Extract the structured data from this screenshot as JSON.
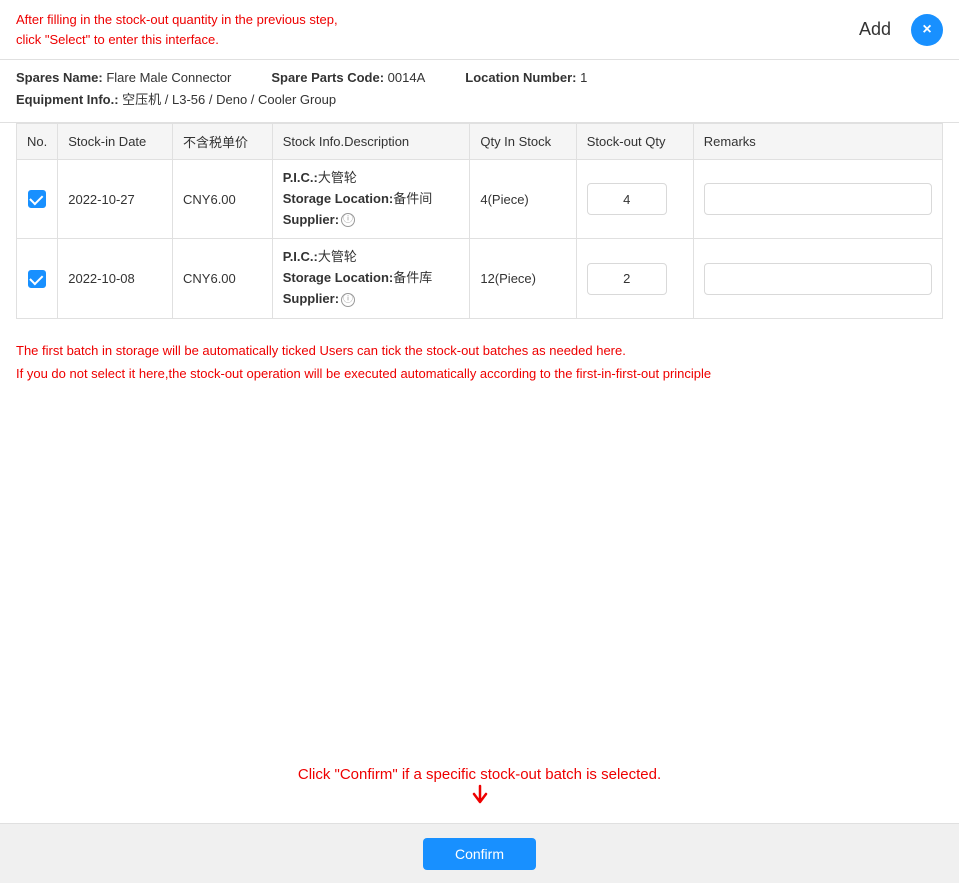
{
  "header": {
    "instruction_line1": "After filling in the stock-out quantity in the previous step,",
    "instruction_line2": "click \"Select\" to enter this interface.",
    "title": "Add",
    "close_icon": "×"
  },
  "product_info": {
    "spares_name_label": "Spares Name:",
    "spares_name_value": "Flare Male Connector",
    "spare_parts_code_label": "Spare Parts Code:",
    "spare_parts_code_value": "0014A",
    "location_number_label": "Location Number:",
    "location_number_value": "1",
    "equipment_info_label": "Equipment Info.:",
    "equipment_info_value": "空压机 / L3-56 / Deno / Cooler Group"
  },
  "table": {
    "columns": [
      "No.",
      "Stock-in Date",
      "不含税单价",
      "Stock Info.Description",
      "Qty In Stock",
      "Stock-out Qty",
      "Remarks"
    ],
    "rows": [
      {
        "checked": true,
        "date": "2022-10-27",
        "unit_price": "CNY6.00",
        "pic": "大管轮",
        "storage_location": "备件间",
        "supplier_label": "Supplier:",
        "qty_in_stock": "4(Piece)",
        "stock_out_qty": "4",
        "remarks": ""
      },
      {
        "checked": true,
        "date": "2022-10-08",
        "unit_price": "CNY6.00",
        "pic": "大管轮",
        "storage_location": "备件库",
        "supplier_label": "Supplier:",
        "qty_in_stock": "12(Piece)",
        "stock_out_qty": "2",
        "remarks": ""
      }
    ]
  },
  "notice": {
    "line1": "The first batch in storage will be automatically ticked  Users can tick the stock-out batches as needed here.",
    "line2": "If you do not select it here,the stock-out operation will be executed automatically according to the first-in-first-out principle"
  },
  "bottom": {
    "instruction": "Click \"Confirm\" if a specific stock-out batch is selected.",
    "confirm_label": "Confirm"
  }
}
